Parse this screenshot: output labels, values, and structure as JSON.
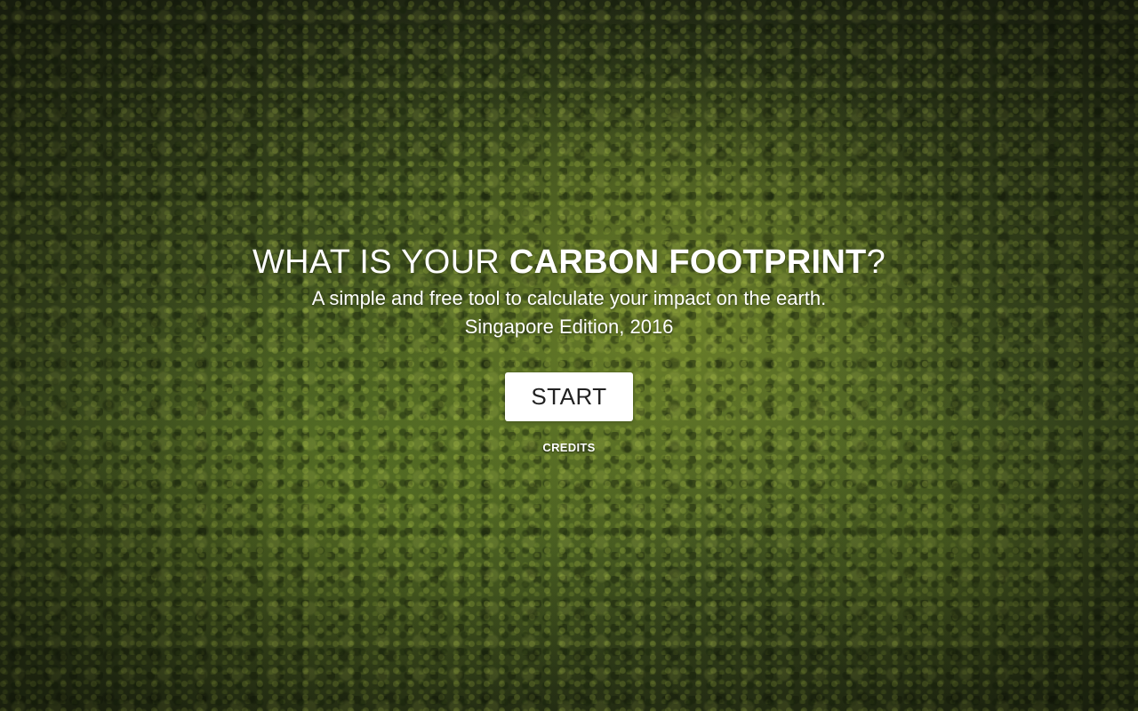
{
  "hero": {
    "title_prefix": "WHAT IS YOUR ",
    "title_emphasis": "CARBON FOOTPRINT",
    "title_suffix": "?",
    "subtitle": "A simple and free tool to calculate your impact on the earth.",
    "edition": "Singapore Edition, 2016"
  },
  "actions": {
    "start_label": "START",
    "credits_label": "CREDITS"
  },
  "colors": {
    "text": "#ffffff",
    "button_bg": "#ffffff",
    "button_text": "#222222",
    "background_tone": "#3a4a1e"
  },
  "background": {
    "description_icon": "forest-canopy-image"
  }
}
